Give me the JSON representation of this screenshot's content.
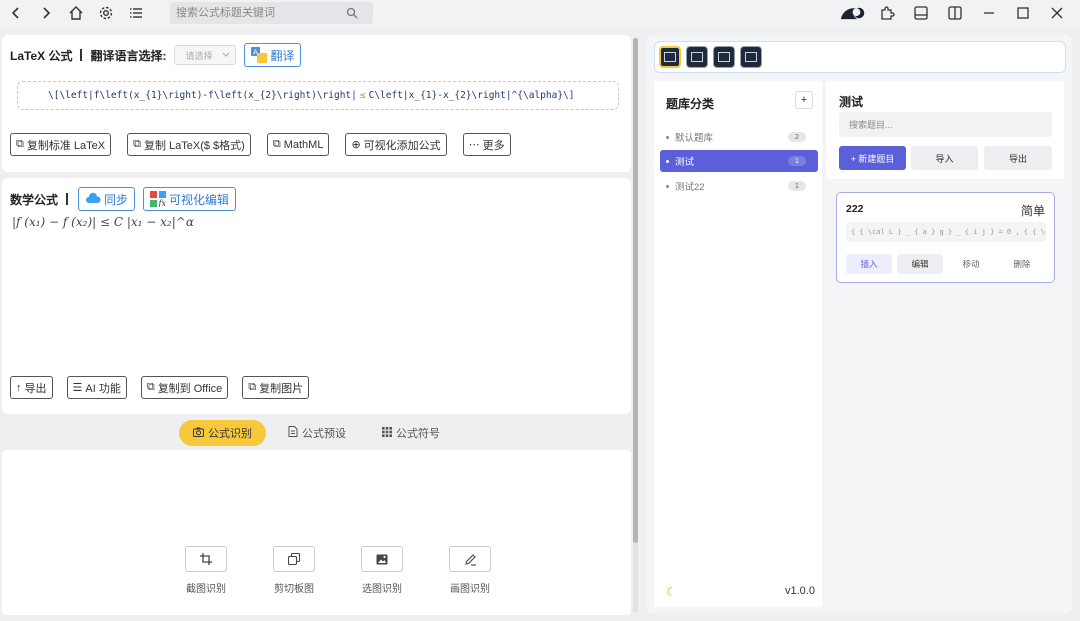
{
  "titlebar": {
    "search_placeholder": "搜索公式标题关键词"
  },
  "latex_section": {
    "title": "LaTeX 公式",
    "translate_label": "翻译语言选择:",
    "select_placeholder": "请选择",
    "translate_button": "翻译",
    "code_part1": "\\[\\left|f\\left(x_{1}\\right)-f\\left(x_{2}\\right)\\right|",
    "code_warn": "≤",
    "code_part2": "C\\left|x_{1}-x_{2}\\right|^{\\alpha}\\]",
    "buttons": [
      "复制标准 LaTeX",
      "复制 LaTeX($ $格式)",
      "MathML",
      "可视化添加公式",
      "更多"
    ]
  },
  "math_section": {
    "title": "数学公式",
    "sync_button": "同步",
    "visual_edit_button": "可视化编辑",
    "rendered": "|f (x₁) − f (x₂)| ≤ C |x₁ − x₂|^α",
    "buttons": [
      "导出",
      "AI 功能",
      "复制到 Office",
      "复制图片"
    ]
  },
  "bottom_tabs": {
    "tabs": [
      "公式识别",
      "公式预设",
      "公式符号"
    ],
    "active": "公式识别"
  },
  "capture_tools": [
    "截图识别",
    "剪切板图",
    "选图识别",
    "画图识别"
  ],
  "question_bank": {
    "categories_title": "题库分类",
    "add_label": "+",
    "categories": [
      {
        "name": "默认题库",
        "count": "2"
      },
      {
        "name": "测试",
        "count": "1"
      },
      {
        "name": "测试22",
        "count": "1"
      }
    ],
    "version": "v1.0.0",
    "current_title": "测试",
    "search_placeholder": "搜索题目...",
    "new_button": "+ 新建题目",
    "import_button": "导入",
    "export_button": "导出",
    "question": {
      "name": "222",
      "difficulty": "简单",
      "latex_preview": "{ { \\cal L } _ { a } g } _ { i j } = 0 , { { \\cal L } _ { a } g } _ { i j }",
      "actions": [
        "插入",
        "编辑",
        "移动",
        "删除"
      ]
    }
  },
  "colors": {
    "accent_purple": "#5b5fd9",
    "accent_yellow": "#f7c83c",
    "accent_blue": "#2f7bd9"
  }
}
